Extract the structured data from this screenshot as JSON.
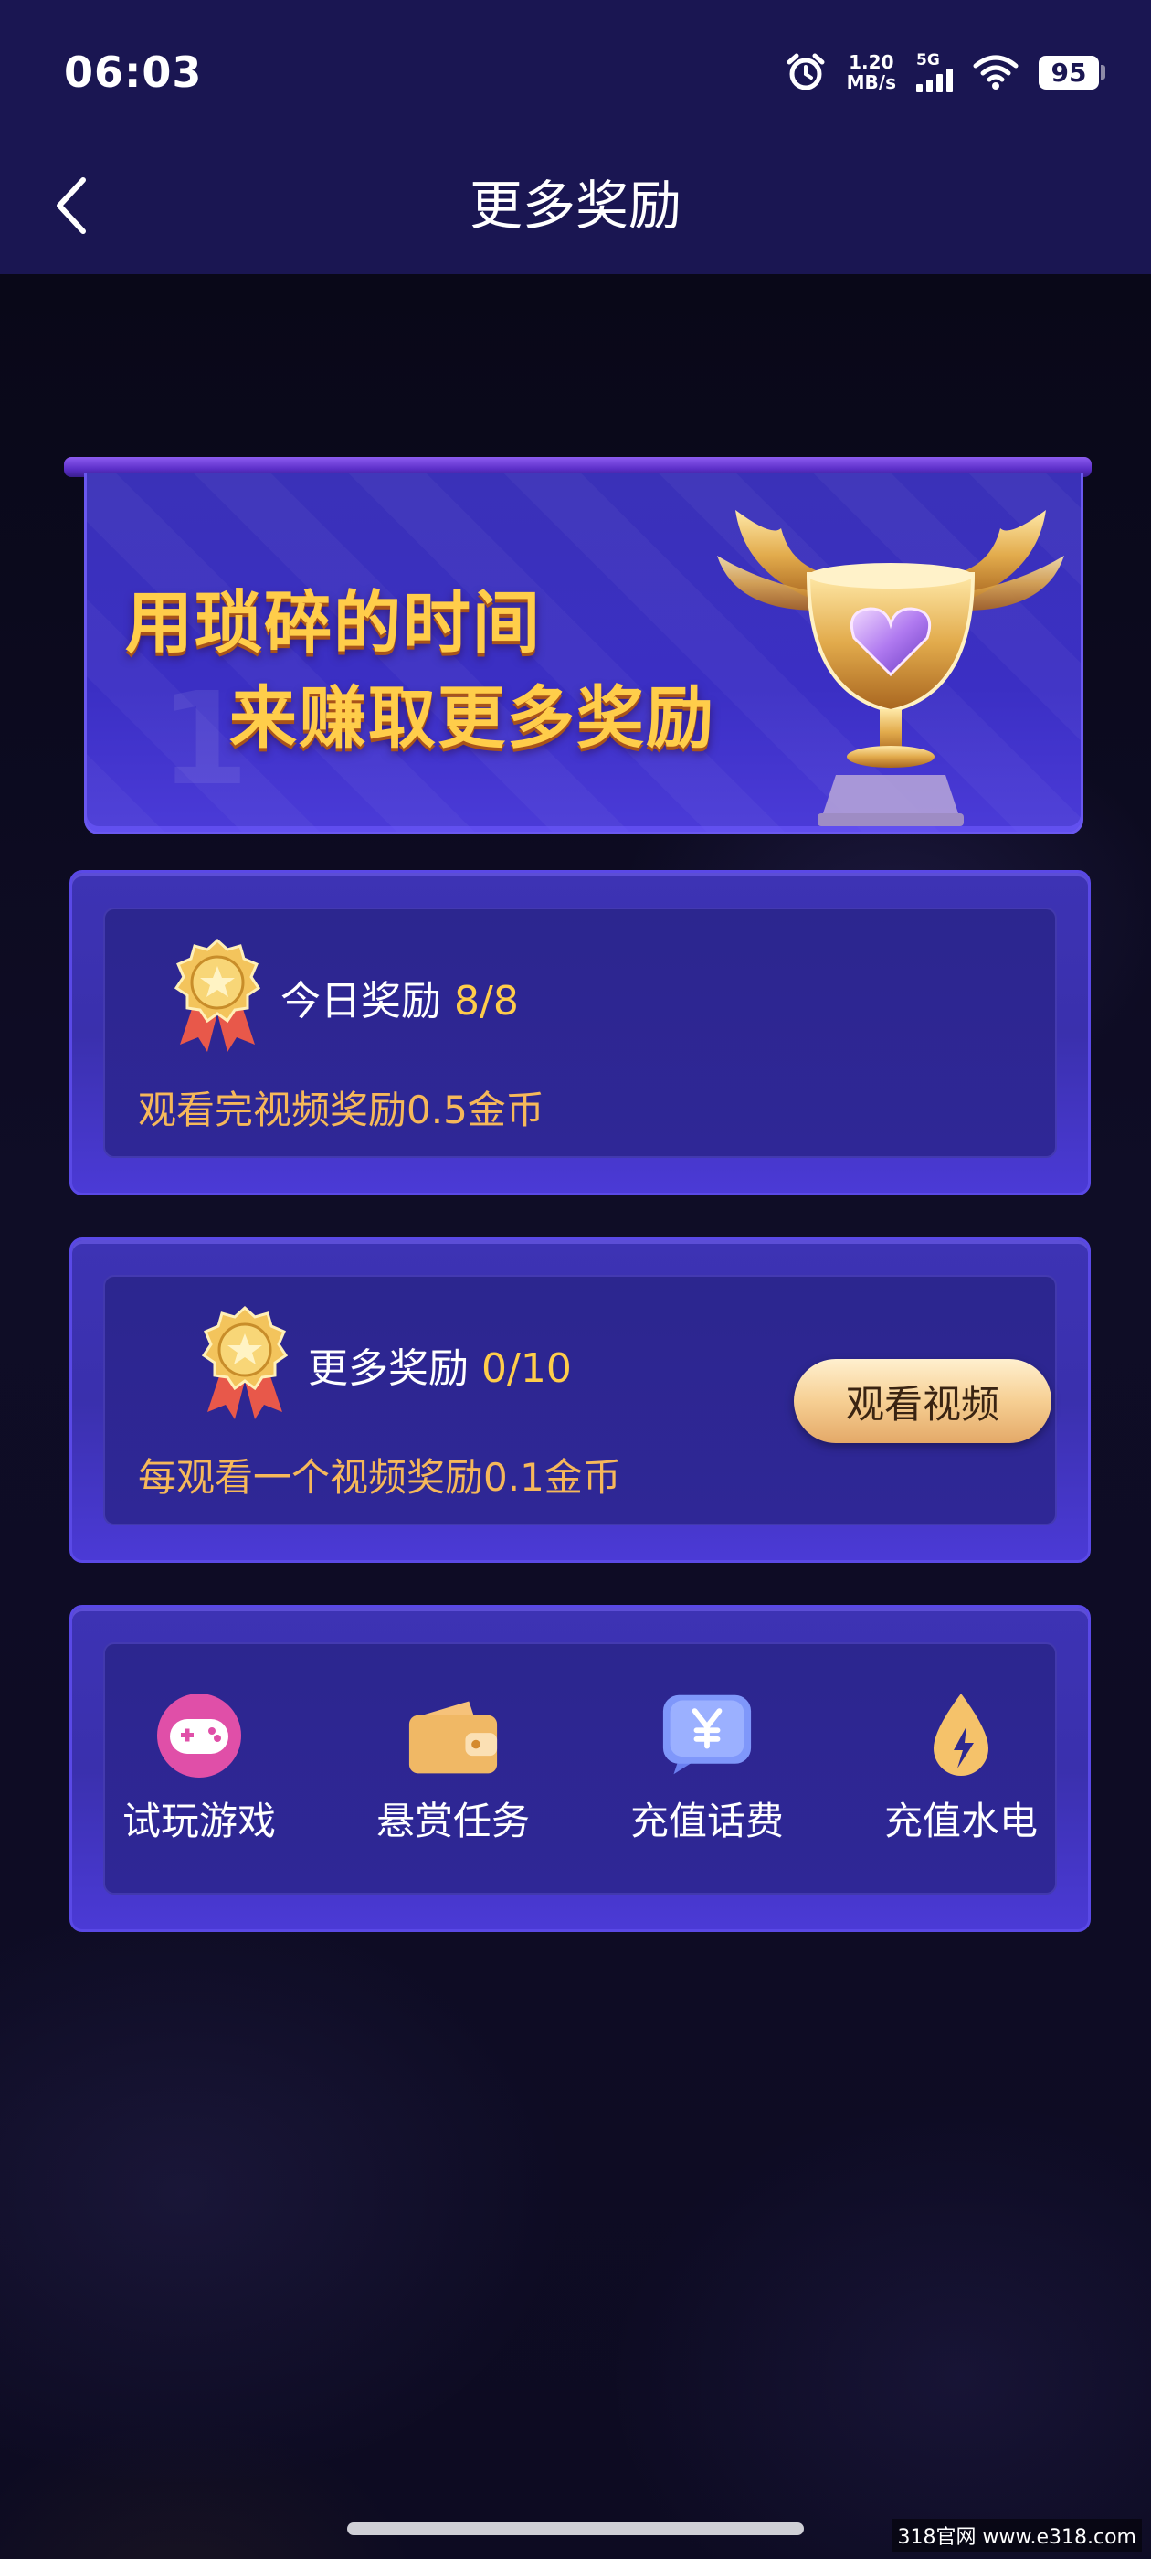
{
  "status_bar": {
    "time": "06:03",
    "net_speed_value": "1.20",
    "net_speed_unit": "MB/s",
    "network": "5G",
    "battery": "95"
  },
  "header": {
    "title": "更多奖励"
  },
  "banner": {
    "line1": "用琐碎的时间",
    "line2": "来赚取更多奖励",
    "deco_number": "1"
  },
  "cards": [
    {
      "title": "今日奖励",
      "count": "8/8",
      "subtitle": "观看完视频奖励0.5金币"
    },
    {
      "title": "更多奖励",
      "count": "0/10",
      "subtitle": "每观看一个视频奖励0.1金币",
      "button_label": "观看视频"
    }
  ],
  "shortcuts": [
    {
      "label": "试玩游戏",
      "icon": "gamepad-icon"
    },
    {
      "label": "悬赏任务",
      "icon": "wallet-icon"
    },
    {
      "label": "充值话费",
      "icon": "yuan-chat-icon"
    },
    {
      "label": "充值水电",
      "icon": "water-drop-icon"
    }
  ],
  "watermark": "318官网 www.e318.com",
  "colors": {
    "header_bg": "#1a1652",
    "accent_gold": "#ffcd4a",
    "subtitle_orange": "#f6b85a",
    "card_bg": "#3a30ad"
  }
}
